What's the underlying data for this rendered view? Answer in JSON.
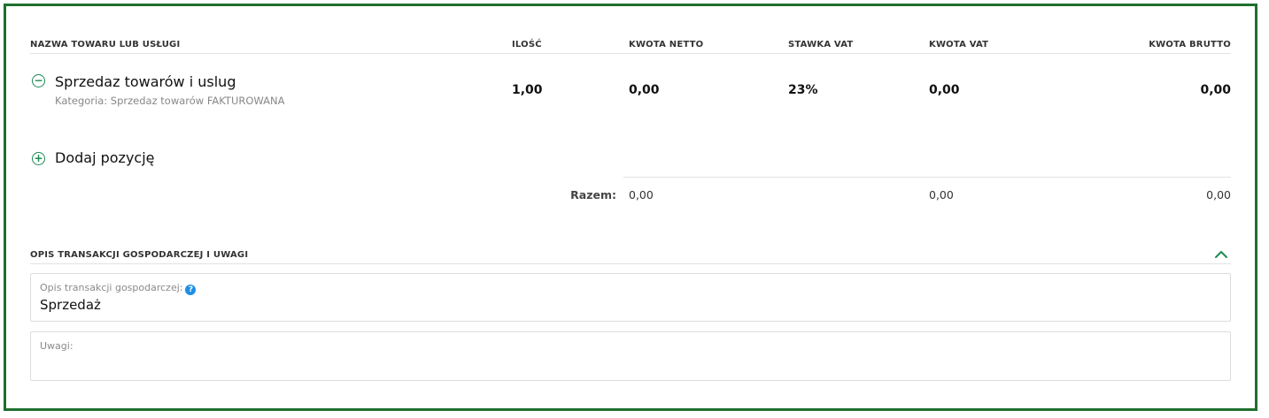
{
  "table": {
    "headers": {
      "name": "NAZWA TOWARU LUB USŁUGI",
      "quantity": "ILOŚĆ",
      "net": "KWOTA NETTO",
      "vat_rate": "STAWKA VAT",
      "vat_amount": "KWOTA VAT",
      "gross": "KWOTA BRUTTO"
    },
    "items": [
      {
        "name": "Sprzedaz towarów i uslug",
        "category": "Kategoria: Sprzedaz towarów FAKTUROWANA",
        "quantity": "1,00",
        "net": "0,00",
        "vat_rate": "23%",
        "vat_amount": "0,00",
        "gross": "0,00",
        "remove_icon": "minus-circle-icon"
      }
    ],
    "add_item": {
      "label": "Dodaj pozycję",
      "icon": "plus-circle-icon"
    },
    "totals": {
      "label": "Razem:",
      "net": "0,00",
      "vat_amount": "0,00",
      "gross": "0,00"
    }
  },
  "description_section": {
    "title": "OPIS TRANSAKCJI GOSPODARCZEJ I UWAGI",
    "collapse_icon": "chevron-up-icon",
    "transaction_field": {
      "label": "Opis transakcji gospodarczej:",
      "value": "Sprzedaż",
      "help_icon": "question-circle-icon",
      "help_glyph": "?"
    },
    "notes_field": {
      "label": "Uwagi:",
      "value": ""
    }
  },
  "colors": {
    "frame_border": "#1f6f2e",
    "accent_green": "#1c8a55",
    "help_blue": "#1f8fe6"
  }
}
